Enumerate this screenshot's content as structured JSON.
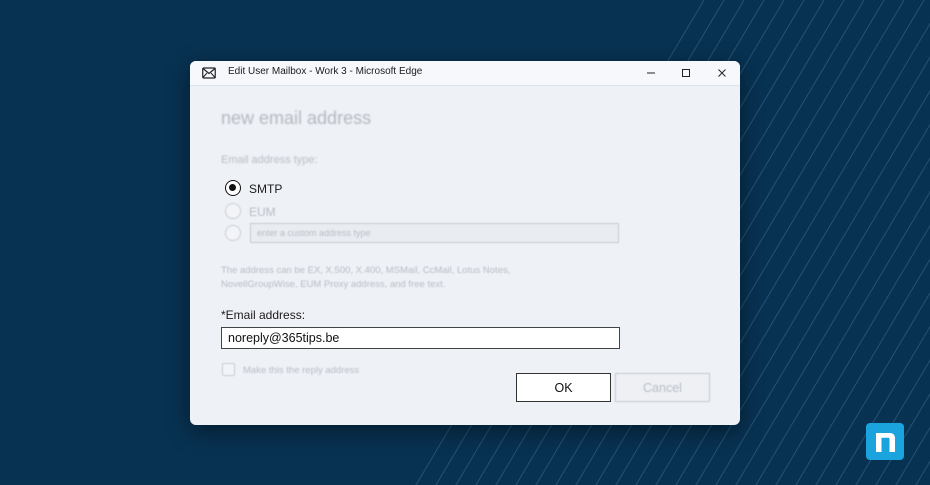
{
  "window": {
    "title": "Edit User Mailbox - Work 3 - Microsoft Edge",
    "controls": {
      "minimize": "—",
      "maximize": "☐",
      "close": "✕"
    }
  },
  "form": {
    "heading": "new email address",
    "address_type_label": "Email address type:",
    "options": [
      {
        "label": "SMTP",
        "selected": true
      },
      {
        "label": "EUM",
        "selected": false
      },
      {
        "placeholder": "enter a custom address type",
        "selected": false
      }
    ],
    "help_line1": "The address can be EX, X.500, X.400, MSMail, CcMail, Lotus Notes,",
    "help_line2": "NovellGroupWise, EUM Proxy address, and free text.",
    "email_label": "*Email address:",
    "email_value": "noreply@365tips.be",
    "reply_checkbox_label": "Make this the reply address",
    "reply_checked": false,
    "ok_label": "OK",
    "cancel_label": "Cancel"
  },
  "colors": {
    "background": "#083252",
    "logo": "#1aa3dc"
  },
  "icons": {
    "title": "mail-icon",
    "logo": "n-logo-icon"
  }
}
